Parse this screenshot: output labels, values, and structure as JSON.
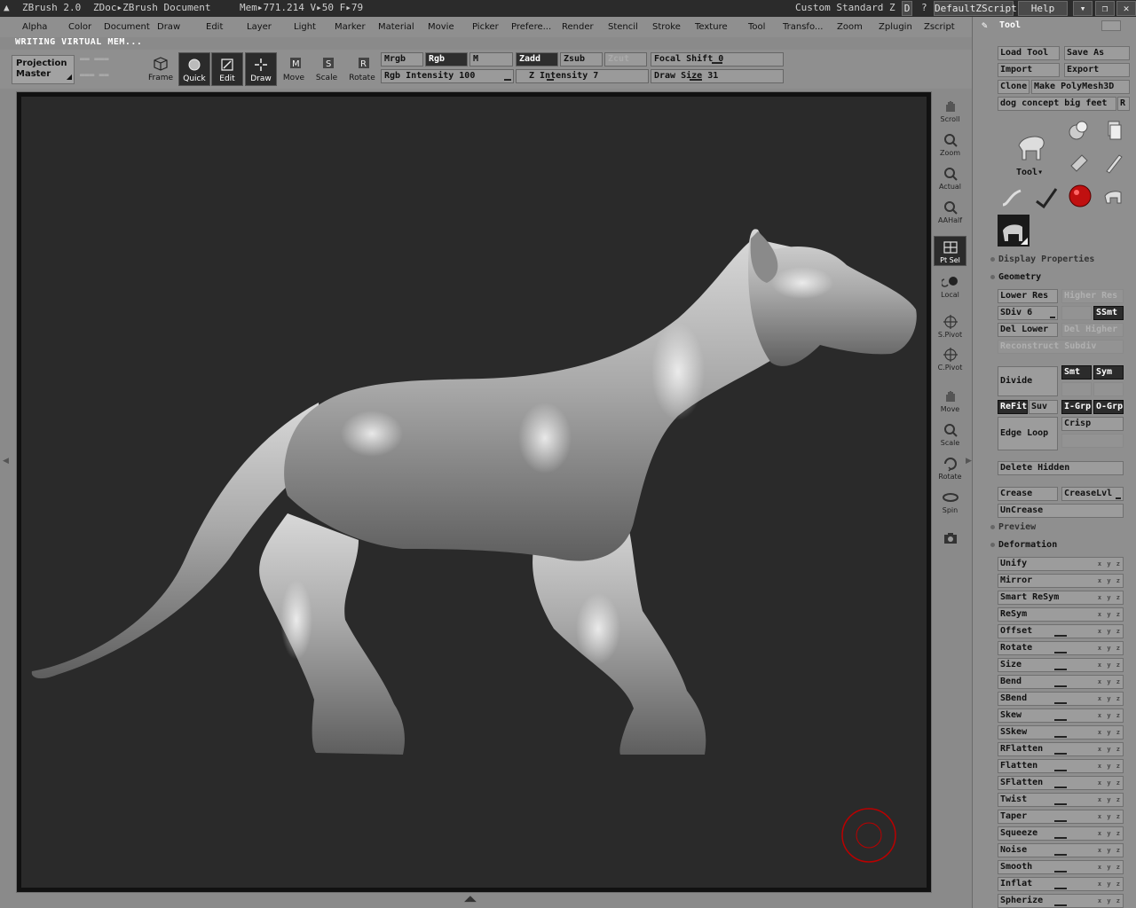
{
  "titlebar": {
    "app": "ZBrush 2.0",
    "doc": "ZDoc▸ZBrush Document",
    "mem": "Mem▸771.214 V▸50 F▸79",
    "layout": "Custom Standard Z",
    "script": "DefaultZScript",
    "help": "Help"
  },
  "menu": [
    "Alpha",
    "Color",
    "Document",
    "Draw",
    "Edit",
    "Layer",
    "Light",
    "Marker",
    "Material",
    "Movie",
    "Picker",
    "Prefere...",
    "Render",
    "Stencil",
    "Stroke",
    "Texture",
    "Tool",
    "Transfo...",
    "Zoom",
    "Zplugin",
    "Zscript"
  ],
  "status": "WRITING VIRTUAL MEM...",
  "toolbar": {
    "projection": "Projection Master",
    "buttons": [
      "Frame",
      "Quick",
      "Edit",
      "Draw",
      "Move",
      "Scale",
      "Rotate"
    ],
    "mrgb": "Mrgb",
    "rgb": "Rgb",
    "m": "M",
    "zadd": "Zadd",
    "zsub": "Zsub",
    "zcut": "Zcut",
    "rgb_intensity": "Rgb Intensity 100",
    "z_intensity": "Z Intensity 7",
    "focal_shift": "Focal Shift 0",
    "draw_size": "Draw Size 31"
  },
  "shelf": [
    "Scroll",
    "Zoom",
    "Actual",
    "AAHalf",
    "Pt Sel",
    "Local",
    "S.Pivot",
    "C.Pivot",
    "Move",
    "Scale",
    "Rotate",
    "Spin"
  ],
  "panel": {
    "title": "Tool",
    "load_tool": "Load Tool",
    "save_as": "Save As",
    "import": "Import",
    "export": "Export",
    "clone": "Clone",
    "make_polymesh": "Make PolyMesh3D",
    "tool_name": "dog concept big feet",
    "r": "R",
    "tool_label": "Tool▾",
    "display_properties": "Display Properties",
    "geometry": "Geometry",
    "lower_res": "Lower Res",
    "higher_res": "Higher Res",
    "sdiv": "SDiv 6",
    "ssmt": "SSmt",
    "del_lower": "Del Lower",
    "del_higher": "Del Higher",
    "reconstruct": "Reconstruct Subdiv",
    "divide": "Divide",
    "smt": "Smt",
    "sym": "Sym",
    "refit": "ReFit",
    "suv": "Suv",
    "igrp": "I-Grp",
    "ogrp": "O-Grp",
    "edge_loop": "Edge Loop",
    "crisp": "Crisp",
    "delete_hidden": "Delete Hidden",
    "crease": "Crease",
    "creaselvl": "CreaseLvl",
    "uncrease": "UnCrease",
    "preview": "Preview",
    "deformation": "Deformation",
    "xyz": "x y z",
    "deform": [
      "Unify",
      "Mirror",
      "Smart ReSym",
      "ReSym",
      "Offset",
      "Rotate",
      "Size",
      "Bend",
      "SBend",
      "Skew",
      "SSkew",
      "RFlatten",
      "Flatten",
      "SFlatten",
      "Twist",
      "Taper",
      "Squeeze",
      "Noise",
      "Smooth",
      "Inflat",
      "Spherize"
    ]
  }
}
